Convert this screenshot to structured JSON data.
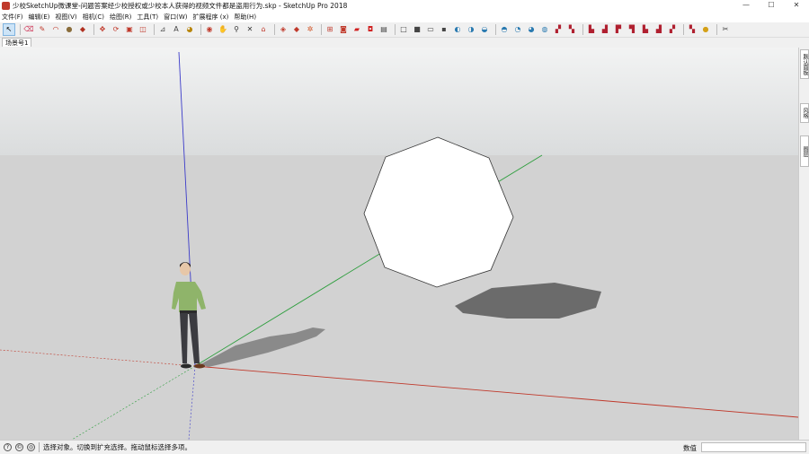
{
  "window": {
    "title": "少校SketchUp微课堂-问题答案经少校授权或少校本人获得的视频文件都是盗用行为.skp - SketchUp Pro 2018",
    "minimize": "—",
    "maximize": "☐",
    "close": "✕"
  },
  "menu": [
    "文件(F)",
    "编辑(E)",
    "视图(V)",
    "相机(C)",
    "绘图(R)",
    "工具(T)",
    "窗口(W)",
    "扩展程序 (x)",
    "帮助(H)"
  ],
  "toolbar": {
    "tools": [
      {
        "name": "select-tool",
        "glyph": "↖",
        "color": "#000000"
      },
      {
        "name": "eraser-tool",
        "glyph": "⌫",
        "color": "#d04060"
      },
      {
        "name": "line-tool",
        "glyph": "✎",
        "color": "#c0392b"
      },
      {
        "name": "arc-tool",
        "glyph": "◠",
        "color": "#c0392b"
      },
      {
        "name": "shapes-tool",
        "glyph": "●",
        "color": "#8a6d3b"
      },
      {
        "name": "push-pull-tool",
        "glyph": "◆",
        "color": "#b03020"
      },
      {
        "name": "move-tool",
        "glyph": "✥",
        "color": "#c0392b"
      },
      {
        "name": "rotate-tool",
        "glyph": "⟳",
        "color": "#c0392b"
      },
      {
        "name": "scale-tool",
        "glyph": "▣",
        "color": "#c0392b"
      },
      {
        "name": "offset-tool",
        "glyph": "◫",
        "color": "#c0392b"
      },
      {
        "name": "tape-measure-tool",
        "glyph": "⊿",
        "color": "#444444"
      },
      {
        "name": "text-tool",
        "glyph": "A",
        "color": "#444444"
      },
      {
        "name": "paint-bucket-tool",
        "glyph": "◕",
        "color": "#b8860b"
      },
      {
        "name": "orbit-tool",
        "glyph": "◉",
        "color": "#c0392b"
      },
      {
        "name": "pan-tool",
        "glyph": "✋",
        "color": "#c08040"
      },
      {
        "name": "zoom-tool",
        "glyph": "⚲",
        "color": "#333333"
      },
      {
        "name": "zoom-extents-tool",
        "glyph": "✕",
        "color": "#333333"
      },
      {
        "name": "warehouse-tool",
        "glyph": "⌂",
        "color": "#c0392b"
      },
      {
        "name": "share-tool",
        "glyph": "◈",
        "color": "#c0392b"
      },
      {
        "name": "extension-tool",
        "glyph": "◆",
        "color": "#c0392b"
      },
      {
        "name": "settings-tool",
        "glyph": "✲",
        "color": "#d05020"
      },
      {
        "name": "component-tool",
        "glyph": "⊞",
        "color": "#c0392b"
      },
      {
        "name": "section-tool",
        "glyph": "◙",
        "color": "#c0392b"
      },
      {
        "name": "folder-tool",
        "glyph": "▰",
        "color": "#d02020"
      },
      {
        "name": "camera-tool",
        "glyph": "◘",
        "color": "#d02020"
      },
      {
        "name": "view-iso",
        "glyph": "▤",
        "color": "#444444"
      },
      {
        "name": "view-top",
        "glyph": "□",
        "color": "#444444"
      },
      {
        "name": "view-front",
        "glyph": "■",
        "color": "#444444"
      },
      {
        "name": "view-right",
        "glyph": "▭",
        "color": "#444444"
      },
      {
        "name": "view-back",
        "glyph": "▪",
        "color": "#444444"
      },
      {
        "name": "style-xray",
        "glyph": "◐",
        "color": "#2a7ab0"
      },
      {
        "name": "style-back-edges",
        "glyph": "◑",
        "color": "#2a7ab0"
      },
      {
        "name": "style-wireframe",
        "glyph": "◒",
        "color": "#2a7ab0"
      },
      {
        "name": "style-hidden-line",
        "glyph": "◓",
        "color": "#2a7ab0"
      },
      {
        "name": "style-shaded",
        "glyph": "◔",
        "color": "#2a7ab0"
      },
      {
        "name": "style-textured",
        "glyph": "◕",
        "color": "#2a7ab0"
      },
      {
        "name": "style-monochrome",
        "glyph": "◍",
        "color": "#2a7ab0"
      },
      {
        "name": "sandbox-tool-1",
        "glyph": "▞",
        "color": "#b02030"
      },
      {
        "name": "sandbox-tool-2",
        "glyph": "▚",
        "color": "#b02030"
      },
      {
        "name": "sandbox-tool-3",
        "glyph": "▙",
        "color": "#b02030"
      },
      {
        "name": "sandbox-tool-4",
        "glyph": "▟",
        "color": "#b02030"
      },
      {
        "name": "solid-tool-1",
        "glyph": "▛",
        "color": "#b02030"
      },
      {
        "name": "solid-tool-2",
        "glyph": "▜",
        "color": "#b02030"
      },
      {
        "name": "solid-tool-3",
        "glyph": "▙",
        "color": "#b02030"
      },
      {
        "name": "solid-tool-4",
        "glyph": "▟",
        "color": "#b02030"
      },
      {
        "name": "solid-tool-5",
        "glyph": "▞",
        "color": "#b02030"
      },
      {
        "name": "solid-tool-6",
        "glyph": "▚",
        "color": "#b02030"
      },
      {
        "name": "plugin-tool-1",
        "glyph": "●",
        "color": "#d4a017"
      },
      {
        "name": "plugin-tool-2",
        "glyph": "✂",
        "color": "#444444"
      }
    ]
  },
  "scenes": {
    "tab1": "场景号1"
  },
  "right_panel": {
    "tabs": [
      "默认面板",
      "风格",
      "图层"
    ]
  },
  "status": {
    "message": "选择对象。切换到扩充选择。拖动鼠标选择多项。",
    "measure_label": "数值",
    "measure_value": ""
  },
  "colors": {
    "sky": "#dadcdd",
    "ground": "#d2d2d2",
    "axis_red": "#c0392b",
    "axis_green": "#2e9e3e",
    "axis_blue": "#3b3bc9",
    "shadow": "#6b6b6b",
    "shirt": "#8fb46a"
  }
}
